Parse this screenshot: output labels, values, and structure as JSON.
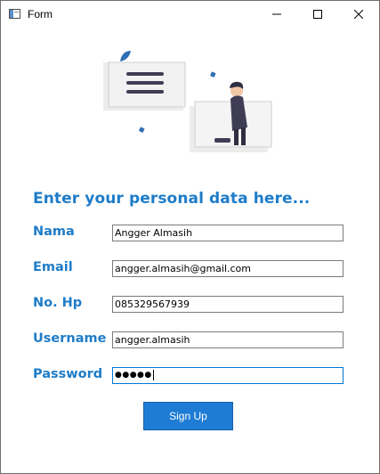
{
  "window": {
    "title": "Form"
  },
  "heading": "Enter your personal data here...",
  "fields": [
    {
      "label": "Nama",
      "value": "Angger Almasih"
    },
    {
      "label": "Email",
      "value": "angger.almasih@gmail.com"
    },
    {
      "label": "No. Hp",
      "value": "085329567939"
    },
    {
      "label": "Username",
      "value": "angger.almasih"
    },
    {
      "label": "Password",
      "value": "●●●●●"
    }
  ],
  "signup_button": "Sign Up",
  "colors": {
    "accent": "#1e7cc8",
    "button": "#1e7cd4",
    "illustration_person": "#3f3d56"
  },
  "icons": [
    "form-app-icon",
    "minimize-icon",
    "maximize-icon",
    "close-icon"
  ]
}
